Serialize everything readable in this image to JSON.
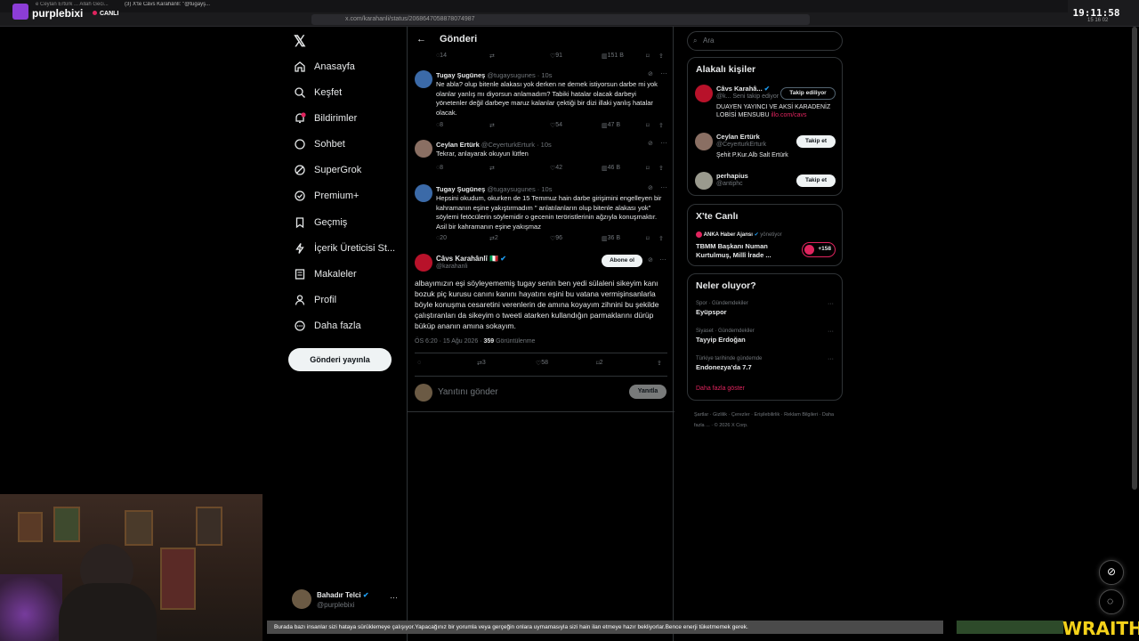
{
  "browser": {
    "tabs": [
      "e Ceylan Ertürk ... Allah Geci...",
      "(3) X'te Câvs Karahânlî: \"@tugayş..."
    ],
    "url": "x.com/karahanli/status/2068647058878074987",
    "brand": "purplebixi",
    "live_label": "CANLI",
    "clock": "19:11:58",
    "clock_sub": "15  16  02"
  },
  "nav": {
    "items": [
      "Anasayfa",
      "Keşfet",
      "Bildirimler",
      "Sohbet",
      "SuperGrok",
      "Premium+",
      "Geçmiş",
      "İçerik Üreticisi St...",
      "Makaleler",
      "Profil",
      "Daha fazla"
    ],
    "notification_count": "1",
    "post_button": "Gönderi yayınla",
    "me_name": "Bahadır Telci",
    "me_handle": "@purplebixi"
  },
  "center": {
    "title": "Gönderi",
    "top_stats": {
      "replies": "14",
      "likes": "91",
      "views": "151 B"
    },
    "replies": [
      {
        "name": "Tugay Şugüneş",
        "handle": "@tugaysugunes · 10s",
        "text": "Ne abla? olup bitenle alakası yok derken ne demek istiyorsun darbe mi yok olanlar yanlış mı diyorsun anlamadım? Tabiki hatalar olacak darbeyi yönetenler değil darbeye maruz kalanlar çektiği bir dizi illaki yanlış hatalar olacak.",
        "stats": {
          "replies": "8",
          "retweets": "",
          "likes": "54",
          "views": "47 B"
        }
      },
      {
        "name": "Ceylan Ertürk",
        "handle": "@CeyerturkErturk · 10s",
        "text": "Tekrar, anlayarak  okuyun lütfen",
        "stats": {
          "replies": "8",
          "retweets": "",
          "likes": "42",
          "views": "46 B"
        }
      },
      {
        "name": "Tugay Şugüneş",
        "handle": "@tugaysugunes · 10s",
        "text": "Hepsini okudum, okurken de 15 Temmuz hain darbe girişimini engelleyen bir kahramanın eşine yakıştırmadım \" anlatılanların olup bitenle alakası yok\" söylemi fetöcülerin söylemidir o gecenin teröristlerinin ağzıyla konuşmaktır. Asil bir kahramanın eşine yakışmaz",
        "stats": {
          "replies": "20",
          "retweets": "2",
          "likes": "96",
          "views": "36 B"
        }
      }
    ],
    "main": {
      "name": "Câvs Karahânlî 🇮🇹",
      "handle": "@karahanli",
      "follow": "Abone ol",
      "text": "albayımızın eşi söyleyememiş tugay senin ben yedi sülaleni sikeyim kanı bozuk piç kurusu canını kanını hayatını eşini bu vatana vermişinsanlarla böyle konuşma cesaretini verenlerin de amına koyayım zihnini bu şekilde çalıştıranları da sikeyim o tweeti atarken kullandığın parmaklarını dürüp büküp ananın amına sokayım.",
      "time": "ÖS 6:20 · 15 Ağu 2026 · ",
      "views": "359",
      "views_label": " Görüntülenme",
      "retweets": "3",
      "likes": "58",
      "bookmarks": "2"
    },
    "compose_placeholder": "Yanıtını gönder",
    "compose_button": "Yanıtla"
  },
  "right": {
    "search_placeholder": "Ara",
    "people_title": "Alakalı kişiler",
    "people": [
      {
        "name": "Câvs Karahâ...",
        "handle": "@k...  Seni takip ediyor",
        "bio": "DUAYEN YAYINCI VE AKSİ KARADENİZ LOBİSİ MENSUBU ",
        "link": "illo.com/cavs",
        "button": "Takip ediliyor"
      },
      {
        "name": "Ceylan Ertürk",
        "handle": "@CeyerturkErturk",
        "bio": "Şehit P.Kur.Alb Salt Ertürk",
        "link": "",
        "button": "Takip et"
      },
      {
        "name": "perhapius",
        "handle": "@antiphc",
        "bio": "",
        "link": "",
        "button": "Takip et"
      }
    ],
    "live_title": "X'te Canlı",
    "live_source": "ANKA Haber Ajansı",
    "live_role": "yönetiyor",
    "live_text": "TBMM Başkanı Numan Kurtulmuş, Millî İrade ...",
    "live_count": "+158",
    "trends_title": "Neler oluyor?",
    "trends": [
      {
        "category": "Spor · Gündemdekiler",
        "title": "Eyüpspor"
      },
      {
        "category": "Siyaset · Gündemdekiler",
        "title": "Tayyip Erdoğan"
      },
      {
        "category": "Türkiye tarihinde gündemde",
        "title": "Endonezya'da 7.7"
      }
    ],
    "show_more": "Daha fazla göster",
    "footer": "Şartlar  ·  Gizlilik  ·  Çerezler  ·  Erişilebilirlik  ·  Reklam Bilgileri  ·  Daha fazla ...  ·  © 2026 X Corp."
  },
  "overlay": {
    "ticker": "Burada bazı insanlar sizi hataya sürüklemeye çalışıyor.Yapacağınız bir yorumla veya gerçeğin onlara uymamasıyla sizi hain ilan etmeye hazır bekliyorlar.Bence enerji tüketmemek gerek.",
    "wraith": "WRAITH"
  }
}
